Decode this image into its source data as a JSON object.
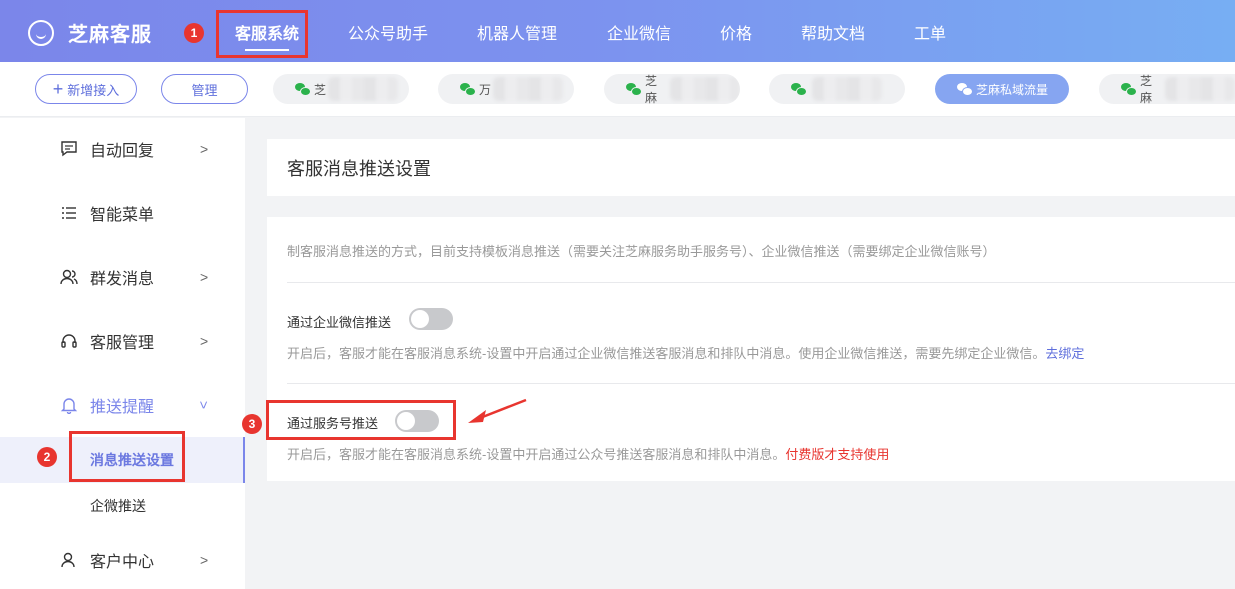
{
  "brand": {
    "name": "芝麻客服",
    "logo_icon": "smile-circle-icon"
  },
  "topnav": {
    "items": [
      {
        "label": "客服系统",
        "active": true
      },
      {
        "label": "公众号助手"
      },
      {
        "label": "机器人管理"
      },
      {
        "label": "企业微信"
      },
      {
        "label": "价格"
      },
      {
        "label": "帮助文档"
      },
      {
        "label": "工单"
      }
    ]
  },
  "accountbar": {
    "add_label": "新增接入",
    "manage_label": "管理",
    "accounts": [
      {
        "label": "芝"
      },
      {
        "label": "万"
      },
      {
        "label": "芝麻"
      },
      {
        "label": ""
      },
      {
        "label": "芝麻私域流量",
        "active": true
      },
      {
        "label": "芝麻"
      }
    ]
  },
  "sidebar": {
    "items": [
      {
        "label": "自动回复",
        "icon": "message-square-icon"
      },
      {
        "label": "智能菜单",
        "icon": "list-icon"
      },
      {
        "label": "群发消息",
        "icon": "users-icon"
      },
      {
        "label": "客服管理",
        "icon": "headset-icon"
      },
      {
        "label": "推送提醒",
        "icon": "bell-icon",
        "open": true
      },
      {
        "label": "客户中心",
        "icon": "user-icon"
      }
    ],
    "sub_items": [
      {
        "label": "消息推送设置",
        "active": true
      },
      {
        "label": "企微推送"
      }
    ]
  },
  "annotations": {
    "step1": "1",
    "step2": "2",
    "step3": "3"
  },
  "main": {
    "title": "客服消息推送设置",
    "description": "制客服消息推送的方式，目前支持模板消息推送（需要关注芝麻服务助手服务号）、企业微信推送（需要绑定企业微信账号）",
    "options": [
      {
        "label": "通过企业微信推送",
        "enabled": false,
        "hint": "开启后，客服才能在客服消息系统-设置中开启通过企业微信推送客服消息和排队中消息。使用企业微信推送，需要先绑定企业微信。",
        "link": "去绑定"
      },
      {
        "label": "通过服务号推送",
        "enabled": false,
        "hint": "开启后，客服才能在客服消息系统-设置中开启通过公众号推送客服消息和排队中消息。",
        "warn": "付费版才支持使用"
      }
    ]
  },
  "colors": {
    "accent": "#7b86ea",
    "annotation_red": "#e8352f",
    "wechat_green": "#2bb24c"
  }
}
